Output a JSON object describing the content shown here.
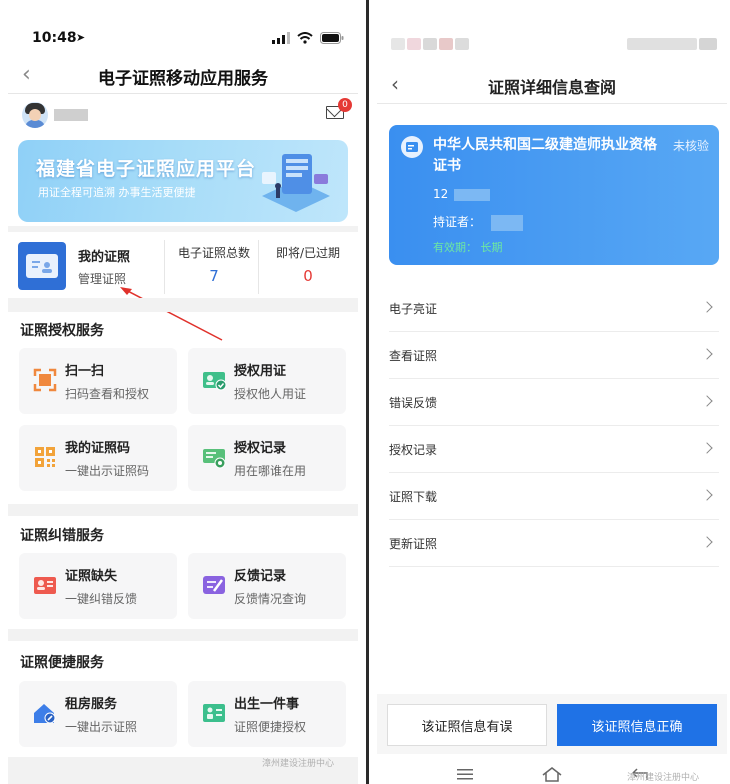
{
  "left": {
    "status": {
      "time": "10:48"
    },
    "nav": {
      "title": "电子证照移动应用服务"
    },
    "mail_badge": "0",
    "banner": {
      "title": "福建省电子证照应用平台",
      "subtitle": "用证全程可追溯   办事生活更便捷"
    },
    "my_cert": {
      "title": "我的证照",
      "subtitle": "管理证照",
      "total_label": "电子证照总数",
      "total_value": "7",
      "expire_label": "即将/已过期",
      "expire_value": "0"
    },
    "sections": [
      {
        "title": "证照授权服务",
        "items": [
          {
            "title": "扫一扫",
            "subtitle": "扫码查看和授权",
            "icon": "scan-icon"
          },
          {
            "title": "授权用证",
            "subtitle": "授权他人用证",
            "icon": "authorize-card-icon"
          },
          {
            "title": "我的证照码",
            "subtitle": "一键出示证照码",
            "icon": "qr-code-icon"
          },
          {
            "title": "授权记录",
            "subtitle": "用在哪谁在用",
            "icon": "record-icon"
          }
        ]
      },
      {
        "title": "证照纠错服务",
        "items": [
          {
            "title": "证照缺失",
            "subtitle": "一键纠错反馈",
            "icon": "missing-card-icon"
          },
          {
            "title": "反馈记录",
            "subtitle": "反馈情况查询",
            "icon": "feedback-edit-icon"
          }
        ]
      },
      {
        "title": "证照便捷服务",
        "items": [
          {
            "title": "租房服务",
            "subtitle": "一键出示证照",
            "icon": "house-key-icon"
          },
          {
            "title": "出生一件事",
            "subtitle": "证照便捷授权",
            "icon": "birth-card-icon"
          }
        ]
      }
    ],
    "watermark": "漳州建设注册中心"
  },
  "right": {
    "nav": {
      "title": "证照详细信息查阅"
    },
    "license": {
      "title": "中华人民共和国二级建造师执业资格证书",
      "status": "未核验",
      "number_prefix": "12",
      "holder_label": "持证者：",
      "validity": "有效期：  长期"
    },
    "menu": [
      {
        "label": "电子亮证"
      },
      {
        "label": "查看证照"
      },
      {
        "label": "错误反馈"
      },
      {
        "label": "授权记录"
      },
      {
        "label": "证照下载"
      },
      {
        "label": "更新证照"
      }
    ],
    "buttons": {
      "error": "该证照信息有误",
      "correct": "该证照信息正确"
    },
    "watermark": "漳州建设注册中心"
  },
  "colors": {
    "primary_blue": "#1f72e6",
    "badge_red": "#e53935",
    "stat_blue": "#2f6fd6",
    "stat_red": "#e53935",
    "validity_green": "#6de7a2"
  }
}
